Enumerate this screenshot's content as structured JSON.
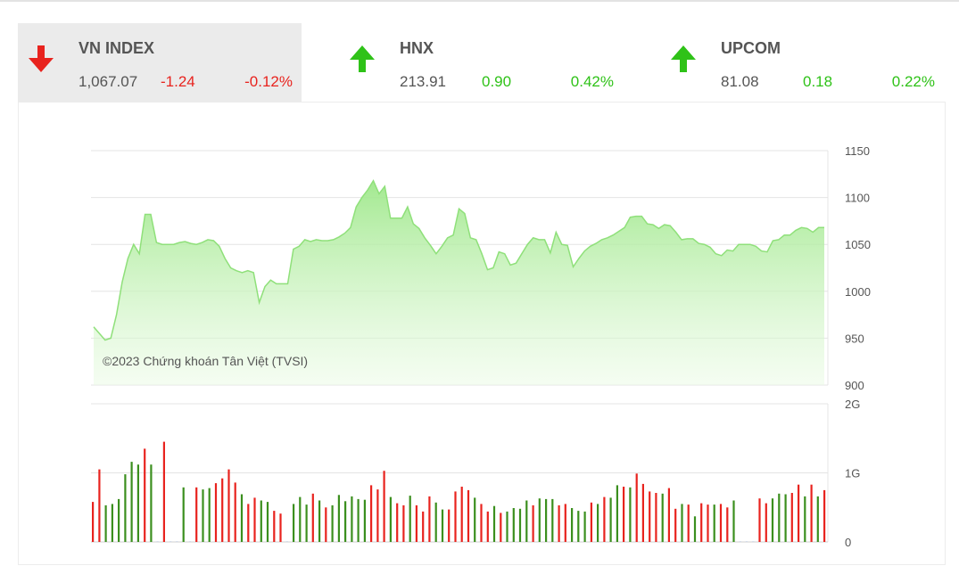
{
  "indices": [
    {
      "name": "VN INDEX",
      "value": "1,067.07",
      "change": "-1.24",
      "percent": "-0.12%",
      "direction": "down"
    },
    {
      "name": "HNX",
      "value": "213.91",
      "change": "0.90",
      "percent": "0.42%",
      "direction": "up"
    },
    {
      "name": "UPCOM",
      "value": "81.08",
      "change": "0.18",
      "percent": "0.22%",
      "direction": "up"
    }
  ],
  "colors": {
    "down": "#e8231e",
    "up": "#2fc218",
    "area_line": "#8fe07a",
    "area_fill": "#b9eeaa",
    "grid": "#e4e4e4"
  },
  "chart_data": {
    "type": "area",
    "watermark": "©2023 Chứng khoán Tân Việt (TVSI)",
    "price": {
      "yticks": [
        "1150",
        "1100",
        "1050",
        "1000",
        "950",
        "900"
      ],
      "ylim": [
        900,
        1150
      ],
      "values": [
        962,
        955,
        948,
        950,
        975,
        1010,
        1035,
        1050,
        1040,
        1082,
        1082,
        1052,
        1050,
        1050,
        1050,
        1052,
        1053,
        1051,
        1050,
        1052,
        1055,
        1054,
        1048,
        1035,
        1025,
        1022,
        1020,
        1022,
        1020,
        988,
        1005,
        1012,
        1008,
        1008,
        1008,
        1045,
        1048,
        1055,
        1053,
        1055,
        1054,
        1054,
        1055,
        1058,
        1062,
        1068,
        1090,
        1100,
        1108,
        1118,
        1104,
        1112,
        1078,
        1078,
        1078,
        1090,
        1072,
        1067,
        1057,
        1049,
        1040,
        1048,
        1057,
        1060,
        1088,
        1083,
        1057,
        1055,
        1040,
        1023,
        1025,
        1042,
        1040,
        1028,
        1030,
        1040,
        1050,
        1057,
        1055,
        1055,
        1041,
        1063,
        1050,
        1049,
        1026,
        1035,
        1043,
        1048,
        1051,
        1055,
        1057,
        1060,
        1064,
        1068,
        1079,
        1080,
        1080,
        1072,
        1071,
        1067,
        1071,
        1070,
        1063,
        1055,
        1056,
        1056,
        1051,
        1050,
        1047,
        1040,
        1038,
        1044,
        1043,
        1050,
        1050,
        1050,
        1048,
        1043,
        1042,
        1054,
        1055,
        1060,
        1060,
        1065,
        1068,
        1067,
        1063,
        1068,
        1068
      ]
    },
    "volume": {
      "yticks": [
        "2G",
        "1G",
        "0"
      ],
      "ylim": [
        0,
        2
      ],
      "bars": [
        {
          "v": 0.58,
          "c": "r"
        },
        {
          "v": 1.05,
          "c": "r"
        },
        {
          "v": 0.53,
          "c": "g"
        },
        {
          "v": 0.55,
          "c": "g"
        },
        {
          "v": 0.62,
          "c": "g"
        },
        {
          "v": 0.98,
          "c": "g"
        },
        {
          "v": 1.16,
          "c": "g"
        },
        {
          "v": 1.12,
          "c": "g"
        },
        {
          "v": 1.35,
          "c": "r"
        },
        {
          "v": 1.12,
          "c": "g"
        },
        {
          "v": 0.01,
          "c": "n"
        },
        {
          "v": 1.45,
          "c": "r"
        },
        {
          "v": 0.01,
          "c": "n"
        },
        {
          "v": 0.01,
          "c": "n"
        },
        {
          "v": 0.79,
          "c": "g"
        },
        {
          "v": 0.01,
          "c": "n"
        },
        {
          "v": 0.79,
          "c": "r"
        },
        {
          "v": 0.76,
          "c": "g"
        },
        {
          "v": 0.78,
          "c": "g"
        },
        {
          "v": 0.85,
          "c": "r"
        },
        {
          "v": 0.92,
          "c": "r"
        },
        {
          "v": 1.05,
          "c": "r"
        },
        {
          "v": 0.86,
          "c": "r"
        },
        {
          "v": 0.69,
          "c": "g"
        },
        {
          "v": 0.55,
          "c": "r"
        },
        {
          "v": 0.64,
          "c": "r"
        },
        {
          "v": 0.6,
          "c": "g"
        },
        {
          "v": 0.58,
          "c": "g"
        },
        {
          "v": 0.45,
          "c": "r"
        },
        {
          "v": 0.41,
          "c": "r"
        },
        {
          "v": 0.01,
          "c": "n"
        },
        {
          "v": 0.55,
          "c": "g"
        },
        {
          "v": 0.65,
          "c": "g"
        },
        {
          "v": 0.54,
          "c": "g"
        },
        {
          "v": 0.7,
          "c": "r"
        },
        {
          "v": 0.6,
          "c": "g"
        },
        {
          "v": 0.5,
          "c": "r"
        },
        {
          "v": 0.53,
          "c": "g"
        },
        {
          "v": 0.68,
          "c": "g"
        },
        {
          "v": 0.59,
          "c": "g"
        },
        {
          "v": 0.66,
          "c": "g"
        },
        {
          "v": 0.62,
          "c": "g"
        },
        {
          "v": 0.61,
          "c": "g"
        },
        {
          "v": 0.82,
          "c": "r"
        },
        {
          "v": 0.76,
          "c": "r"
        },
        {
          "v": 1.03,
          "c": "r"
        },
        {
          "v": 0.65,
          "c": "g"
        },
        {
          "v": 0.56,
          "c": "r"
        },
        {
          "v": 0.53,
          "c": "r"
        },
        {
          "v": 0.67,
          "c": "g"
        },
        {
          "v": 0.53,
          "c": "r"
        },
        {
          "v": 0.44,
          "c": "r"
        },
        {
          "v": 0.66,
          "c": "r"
        },
        {
          "v": 0.57,
          "c": "g"
        },
        {
          "v": 0.47,
          "c": "g"
        },
        {
          "v": 0.47,
          "c": "r"
        },
        {
          "v": 0.73,
          "c": "r"
        },
        {
          "v": 0.8,
          "c": "r"
        },
        {
          "v": 0.75,
          "c": "r"
        },
        {
          "v": 0.64,
          "c": "g"
        },
        {
          "v": 0.55,
          "c": "r"
        },
        {
          "v": 0.44,
          "c": "r"
        },
        {
          "v": 0.52,
          "c": "g"
        },
        {
          "v": 0.42,
          "c": "r"
        },
        {
          "v": 0.44,
          "c": "g"
        },
        {
          "v": 0.49,
          "c": "g"
        },
        {
          "v": 0.48,
          "c": "g"
        },
        {
          "v": 0.6,
          "c": "g"
        },
        {
          "v": 0.53,
          "c": "r"
        },
        {
          "v": 0.63,
          "c": "g"
        },
        {
          "v": 0.62,
          "c": "g"
        },
        {
          "v": 0.62,
          "c": "g"
        },
        {
          "v": 0.53,
          "c": "r"
        },
        {
          "v": 0.55,
          "c": "r"
        },
        {
          "v": 0.49,
          "c": "g"
        },
        {
          "v": 0.45,
          "c": "g"
        },
        {
          "v": 0.44,
          "c": "g"
        },
        {
          "v": 0.57,
          "c": "r"
        },
        {
          "v": 0.55,
          "c": "g"
        },
        {
          "v": 0.65,
          "c": "r"
        },
        {
          "v": 0.64,
          "c": "g"
        },
        {
          "v": 0.82,
          "c": "g"
        },
        {
          "v": 0.8,
          "c": "r"
        },
        {
          "v": 0.79,
          "c": "g"
        },
        {
          "v": 0.99,
          "c": "r"
        },
        {
          "v": 0.84,
          "c": "r"
        },
        {
          "v": 0.73,
          "c": "r"
        },
        {
          "v": 0.71,
          "c": "r"
        },
        {
          "v": 0.7,
          "c": "g"
        },
        {
          "v": 0.78,
          "c": "r"
        },
        {
          "v": 0.48,
          "c": "r"
        },
        {
          "v": 0.55,
          "c": "g"
        },
        {
          "v": 0.54,
          "c": "r"
        },
        {
          "v": 0.37,
          "c": "g"
        },
        {
          "v": 0.56,
          "c": "r"
        },
        {
          "v": 0.54,
          "c": "r"
        },
        {
          "v": 0.54,
          "c": "g"
        },
        {
          "v": 0.55,
          "c": "r"
        },
        {
          "v": 0.5,
          "c": "r"
        },
        {
          "v": 0.6,
          "c": "g"
        },
        {
          "v": 0.01,
          "c": "n"
        },
        {
          "v": 0.01,
          "c": "n"
        },
        {
          "v": 0.01,
          "c": "n"
        },
        {
          "v": 0.63,
          "c": "r"
        },
        {
          "v": 0.56,
          "c": "r"
        },
        {
          "v": 0.63,
          "c": "g"
        },
        {
          "v": 0.7,
          "c": "g"
        },
        {
          "v": 0.69,
          "c": "g"
        },
        {
          "v": 0.71,
          "c": "r"
        },
        {
          "v": 0.83,
          "c": "r"
        },
        {
          "v": 0.66,
          "c": "g"
        },
        {
          "v": 0.83,
          "c": "r"
        },
        {
          "v": 0.66,
          "c": "g"
        },
        {
          "v": 0.75,
          "c": "r"
        }
      ]
    }
  }
}
